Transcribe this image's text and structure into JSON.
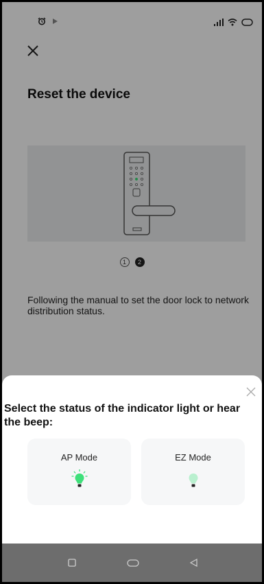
{
  "page": {
    "title": "Reset the device",
    "instructions": "Following the manual to set the door lock to network distribution status."
  },
  "pager": {
    "dots": [
      "1",
      "2"
    ],
    "active_index": 1
  },
  "sheet": {
    "title": "Select the status of the indicator light or hear the beep:",
    "modes": [
      {
        "label": "AP Mode",
        "icon": "blinking-bulb-icon"
      },
      {
        "label": "EZ Mode",
        "icon": "slow-bulb-icon"
      }
    ]
  },
  "colors": {
    "bulb_bright": "#3ee07a",
    "bulb_soft": "#b9f0cf",
    "overlay": "rgba(0,0,0,0.38)",
    "nav_bar": "#6d6d6d"
  },
  "status_bar": {
    "left_icons": [
      "alarm-icon",
      "play-icon"
    ],
    "right_icons": [
      "signal-icon",
      "wifi-icon",
      "battery-icon"
    ]
  },
  "nav_bar": {
    "buttons": [
      "recent-apps-button",
      "home-button",
      "back-button"
    ]
  }
}
